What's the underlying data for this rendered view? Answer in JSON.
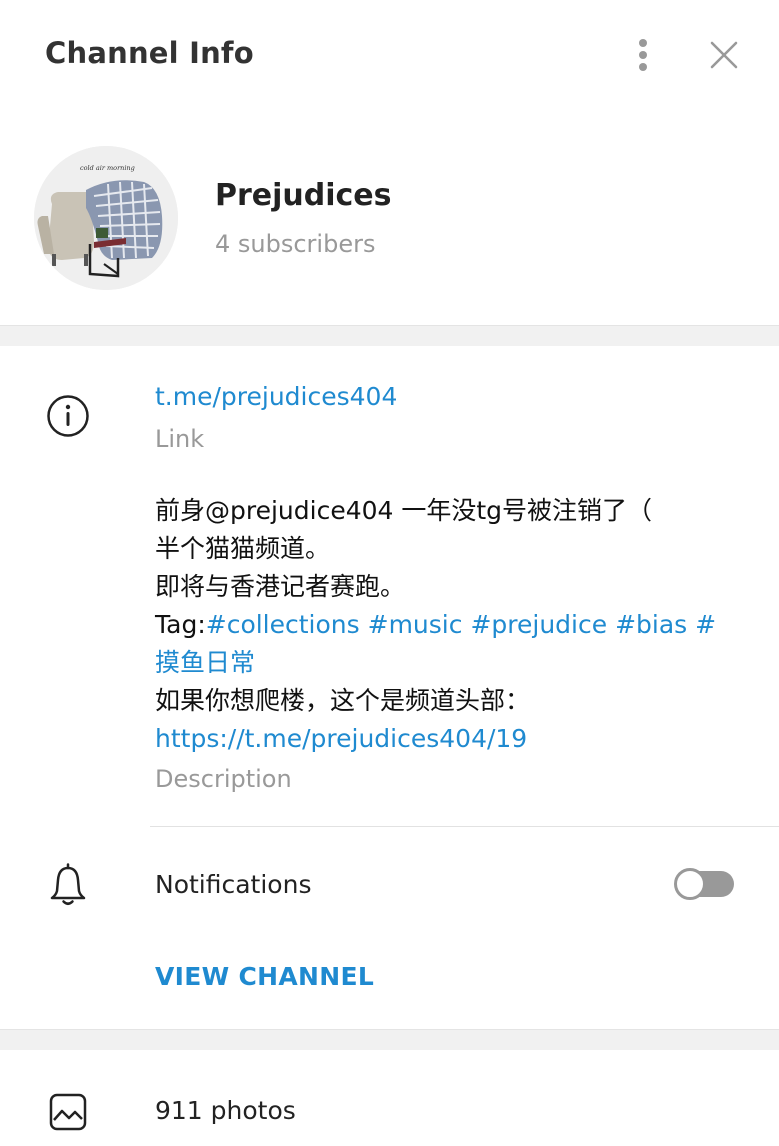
{
  "header": {
    "title": "Channel Info"
  },
  "profile": {
    "name": "Prejudices",
    "subscribers": "4 subscribers",
    "avatar_caption": "cold air morning"
  },
  "info": {
    "link": "t.me/prejudices404",
    "link_label": "Link",
    "description_lines": {
      "line1": "前身@prejudice404 一年没tg号被注销了（",
      "line2": "半个猫猫频道。",
      "line3": "即将与香港记者赛跑。",
      "tag_prefix": "Tag:",
      "tags": [
        "#collections",
        "#music",
        "#prejudice",
        "#bias",
        "#摸鱼日常"
      ],
      "line5": "如果你想爬楼，这个是频道头部：",
      "url": "https://t.me/prejudices404/19"
    },
    "description_label": "Description"
  },
  "notifications": {
    "label": "Notifications",
    "enabled": false
  },
  "actions": {
    "view_channel": "VIEW CHANNEL"
  },
  "media": {
    "photos": "911 photos"
  },
  "colors": {
    "accent": "#1f8ad0",
    "muted": "#999999",
    "text": "#222222",
    "band": "#f1f1f1"
  },
  "icons": [
    "more-vertical-icon",
    "close-icon",
    "info-icon",
    "bell-icon",
    "photo-icon"
  ]
}
